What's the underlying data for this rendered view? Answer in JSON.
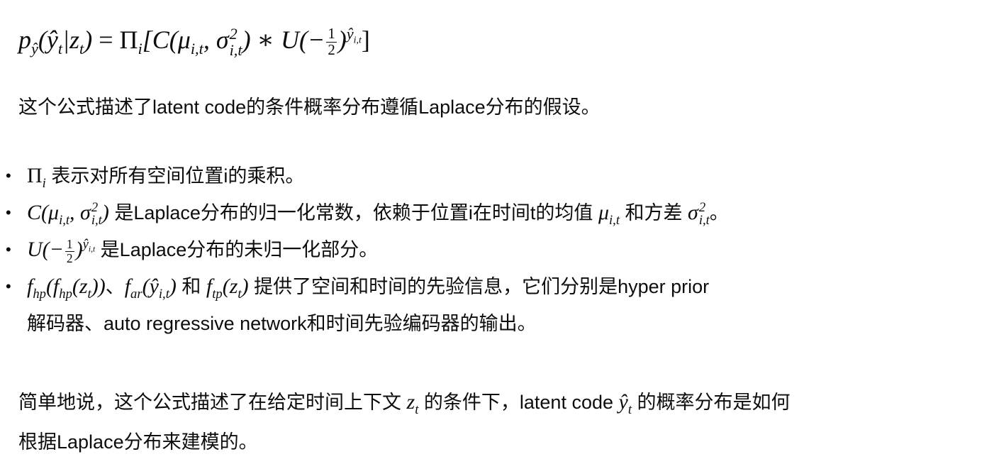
{
  "formula": {
    "p_sub": "ŷ",
    "lhs_arg": "ŷ",
    "lhs_sub": "t",
    "cond": "z",
    "cond_sub": "t",
    "eq": "=",
    "pi": "Π",
    "pi_sub": "i",
    "c_open": "[C(μ",
    "mu_sub": "i,t",
    "sigma": ", σ",
    "sigma_sup": "2",
    "sigma_sub": "i,t",
    "mid": ") ∗ U(−",
    "frac_num": "1",
    "frac_den": "2",
    "exp": "ŷ",
    "exp_sub": "i,t",
    "close": "]"
  },
  "intro": "这个公式描述了latent code的条件概率分布遵循Laplace分布的假设。",
  "bullets": {
    "b1_text": "表示对所有空间位置i的乘积。",
    "b2_text": "是Laplace分布的归一化常数，依赖于位置i在时间t的均值",
    "b2_and": "和方差",
    "b2_end": "。",
    "b3_text": "是Laplace分布的未归一化部分。",
    "b4_sep": "、",
    "b4_and": "和",
    "b4_text": "提供了空间和时间的先验信息，它们分别是hyper prior",
    "b4_cont": "解码器、auto regressive network和时间先验编码器的输出。"
  },
  "summary": {
    "line1_a": "简单地说，这个公式描述了在给定时间上下文",
    "line1_b": "的条件下，latent code",
    "line1_c": "的概率分布是如何",
    "line2": "根据Laplace分布来建模的。"
  }
}
